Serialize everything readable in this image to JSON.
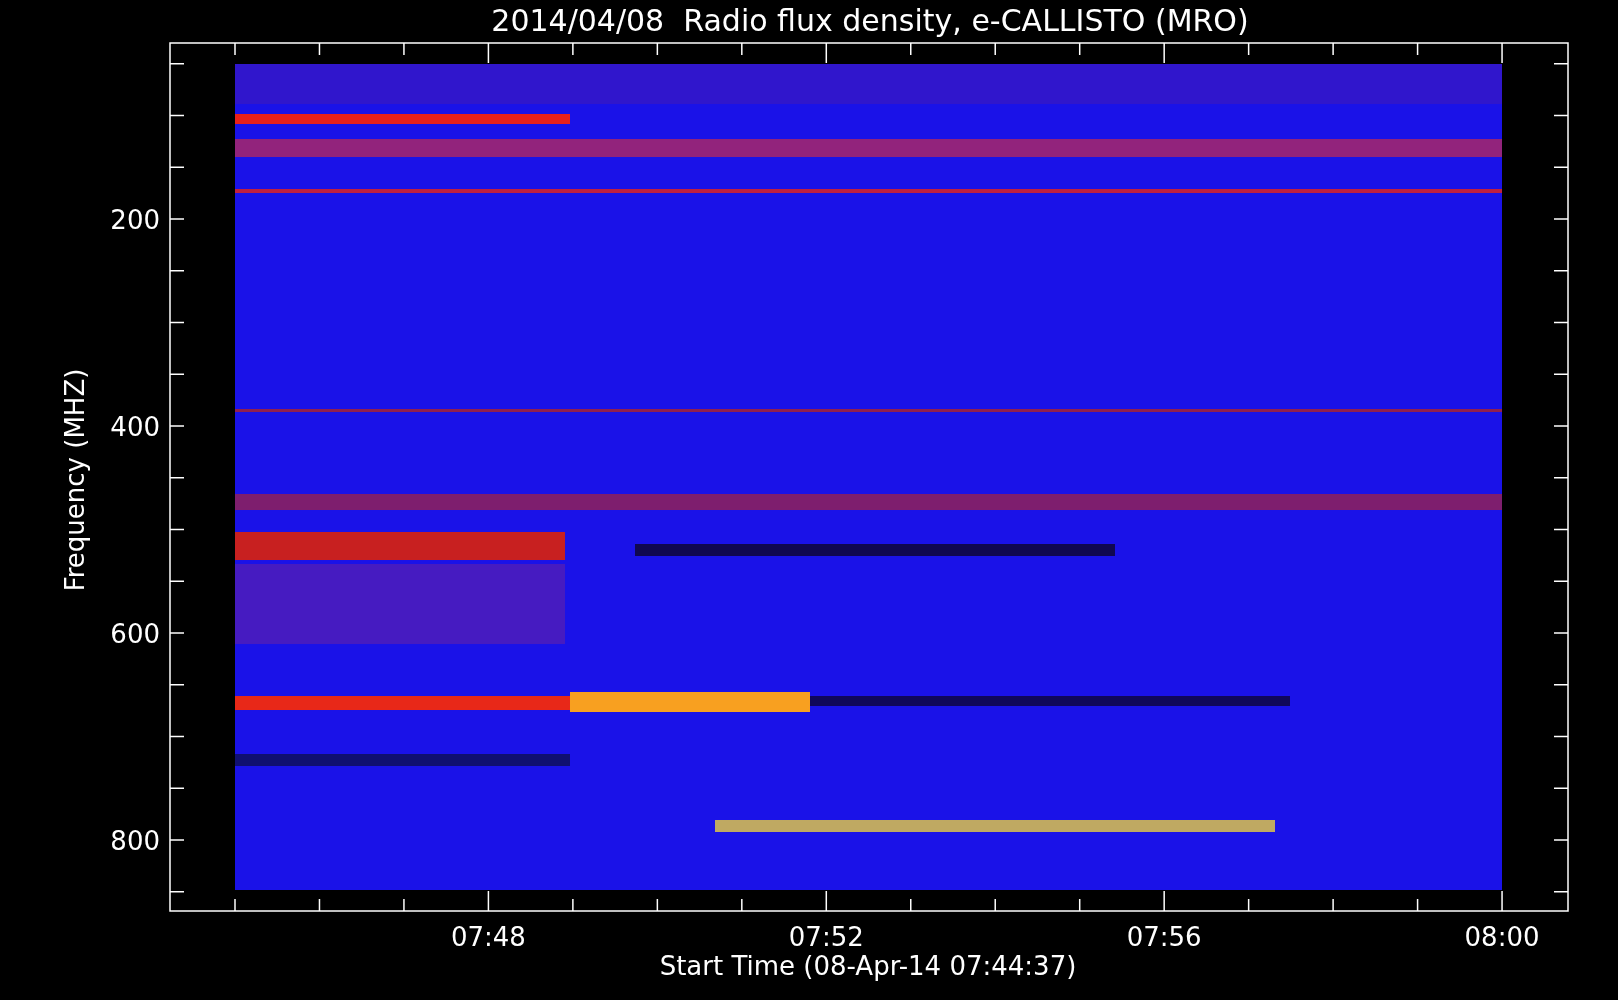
{
  "title": "2014/04/08  Radio flux density, e-CALLISTO (MRO)",
  "y_axis": {
    "label": "Frequency (MHZ)",
    "ticks": [
      "200",
      "400",
      "600",
      "800"
    ]
  },
  "x_axis": {
    "label": "Start Time (08-Apr-14 07:44:37)",
    "ticks": [
      "07:48",
      "07:52",
      "07:56",
      "08:00"
    ]
  }
}
